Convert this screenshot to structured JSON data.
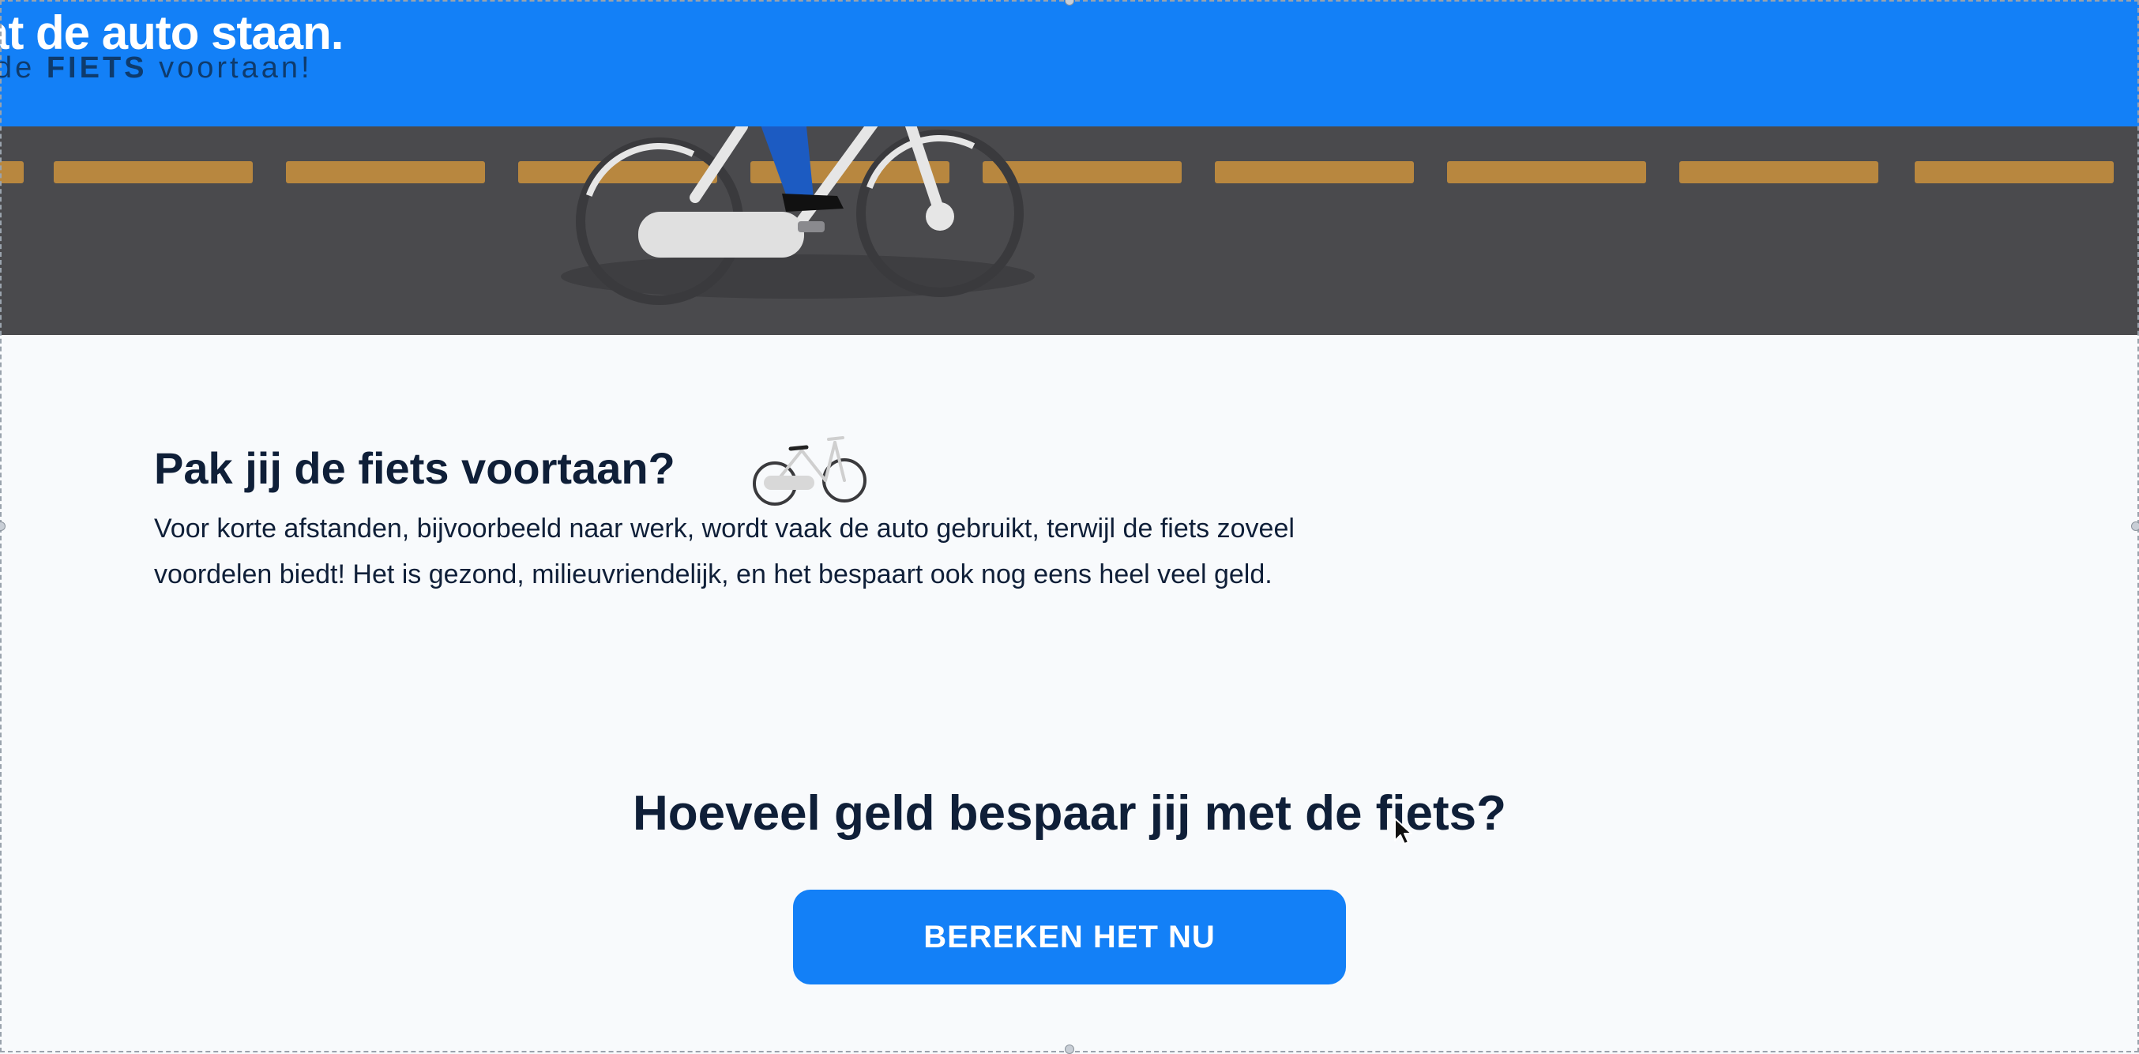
{
  "banner": {
    "headline": "at de auto staan.",
    "sub_before": "de",
    "sub_bold": "FIETS",
    "sub_after": "voortaan!"
  },
  "intro": {
    "title": "Pak jij de fiets voortaan?",
    "text": "Voor korte afstanden, bijvoorbeeld naar werk, wordt vaak de auto gebruikt, terwijl de fiets zoveel voordelen biedt! Het is gezond, milieuvriendelijk, en het bespaart ook nog eens heel veel geld."
  },
  "calculator": {
    "title": "Hoeveel geld bespaar jij met de fiets?",
    "button_label": "BEREKEN HET NU"
  },
  "colors": {
    "brand_blue": "#1380f7",
    "road": "#4a4a4d",
    "lane_marking": "#b8873f",
    "text_dark": "#0f1f38",
    "page_background": "#f8fafc"
  }
}
